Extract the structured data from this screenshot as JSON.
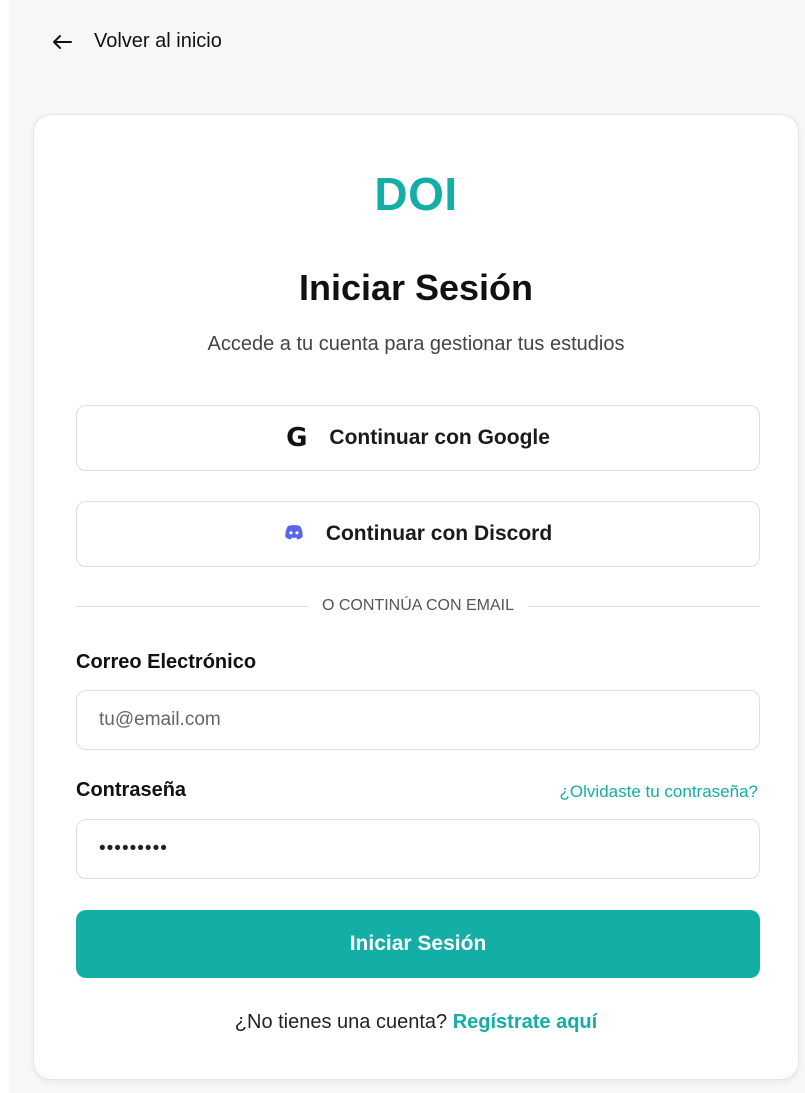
{
  "nav": {
    "back_label": "Volver al inicio"
  },
  "card": {
    "logo": "DOI",
    "title": "Iniciar Sesión",
    "subtitle": "Accede a tu cuenta para gestionar tus estudios"
  },
  "oauth": {
    "google_label": "Continuar con Google",
    "google_icon": "google-icon",
    "discord_label": "Continuar con Discord",
    "discord_icon": "discord-icon"
  },
  "divider_text": "O CONTINÚA CON EMAIL",
  "form": {
    "email_label": "Correo Electrónico",
    "email_placeholder": "tu@email.com",
    "email_value": "",
    "password_label": "Contraseña",
    "password_value": "123456789",
    "forgot_label": "¿Olvidaste tu contraseña?",
    "submit_label": "Iniciar Sesión"
  },
  "signup": {
    "prompt": "¿No tienes una cuenta?",
    "link_label": "Regístrate aquí"
  },
  "colors": {
    "accent": "#13aea5",
    "discord": "#5865f2",
    "background": "#f7f7f7"
  }
}
